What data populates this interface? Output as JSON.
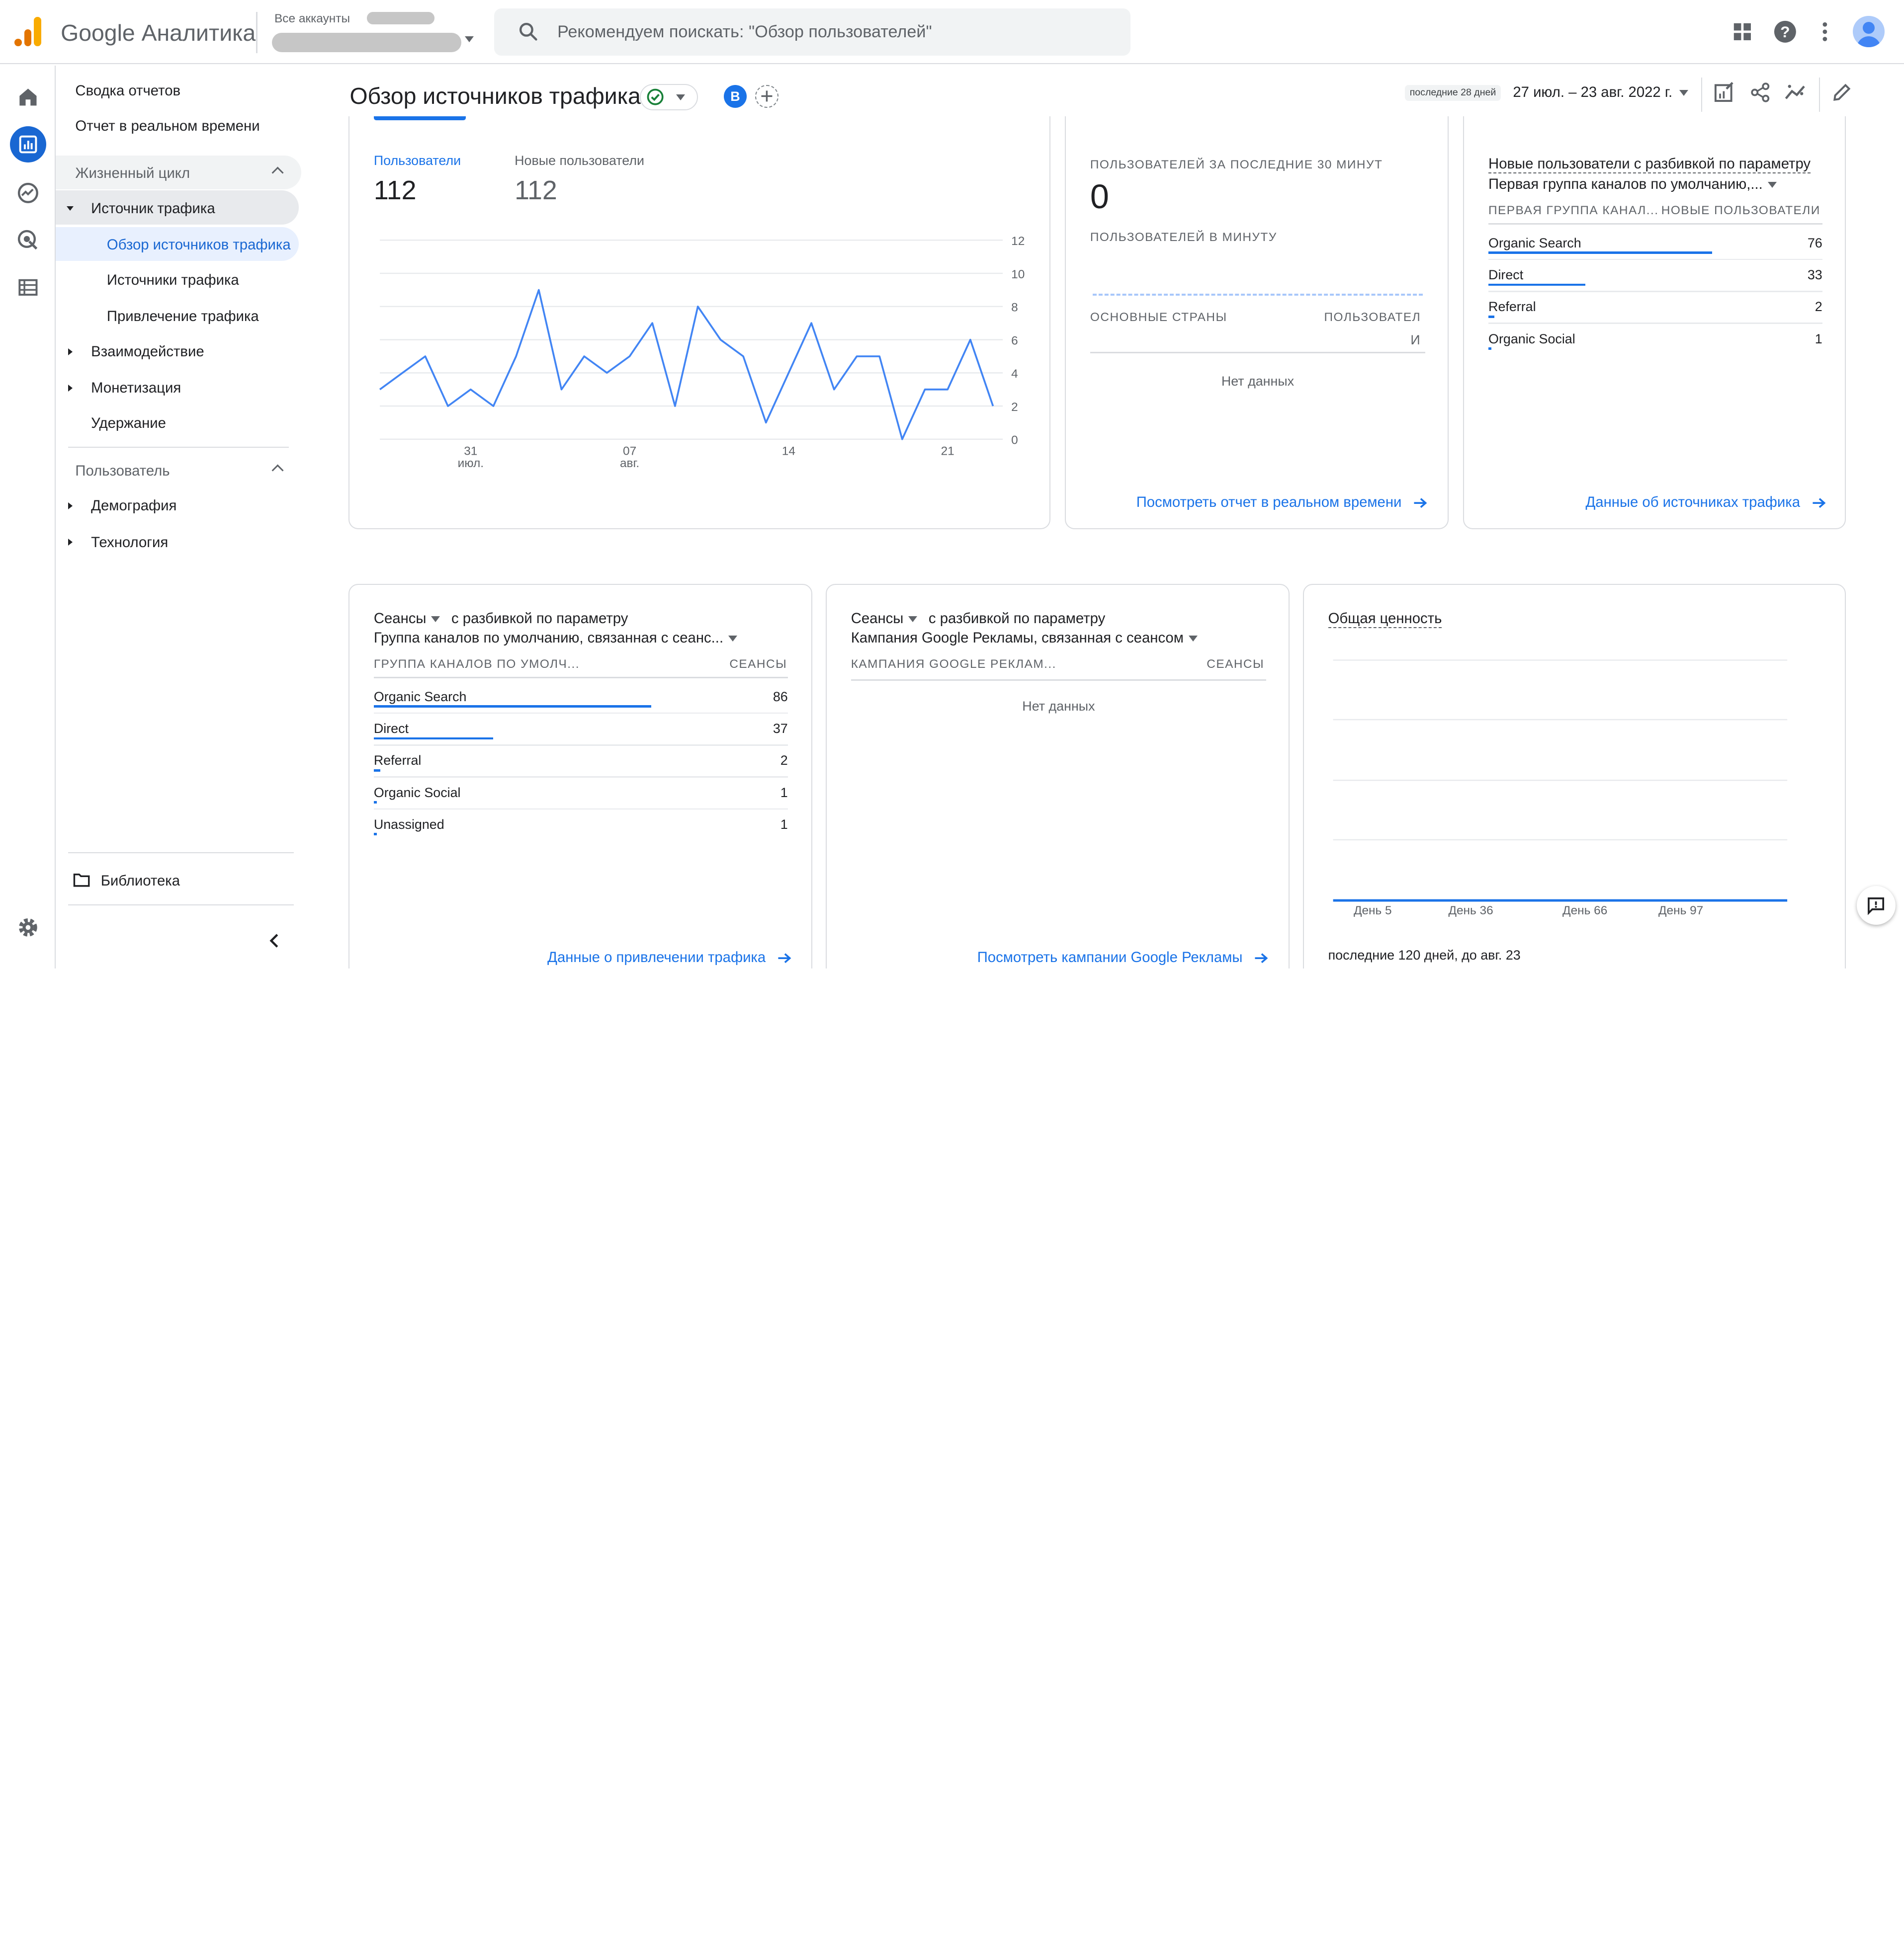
{
  "app": {
    "title": "Google Аналитика",
    "account_label": "Все аккаунты",
    "search_placeholder": "Рекомендуем поискать: \"Обзор пользователей\""
  },
  "nav": {
    "reports_snapshot": "Сводка отчетов",
    "realtime": "Отчет в реальном времени",
    "lifecycle": "Жизненный цикл",
    "acquisition": "Источник трафика",
    "acquisition_overview": "Обзор источников трафика",
    "traffic_sources": "Источники трафика",
    "traffic_acquisition": "Привлечение трафика",
    "engagement": "Взаимодействие",
    "monetization": "Монетизация",
    "retention": "Удержание",
    "user": "Пользователь",
    "demographics": "Демография",
    "tech": "Технология",
    "library": "Библиотека"
  },
  "header": {
    "page_title": "Обзор источников трафика",
    "compare_badge": "В",
    "date_preset": "последние 28 дней",
    "date_range": "27 июл. – 23 авг. 2022 г."
  },
  "users_card": {
    "tab_users": "Пользователи",
    "users_value": "112",
    "tab_new_users": "Новые пользователи",
    "new_users_value": "112",
    "x_labels": [
      {
        "day": "31",
        "month": "июл."
      },
      {
        "day": "07",
        "month": "авг."
      },
      {
        "day": "14",
        "month": ""
      },
      {
        "day": "21",
        "month": ""
      }
    ]
  },
  "chart_data": {
    "type": "line",
    "title": "",
    "xlabel": "",
    "ylabel": "",
    "x": [
      "27 июл.",
      "28 июл.",
      "29 июл.",
      "30 июл.",
      "31 июл.",
      "01 авг.",
      "02 авг.",
      "03 авг.",
      "04 авг.",
      "05 авг.",
      "06 авг.",
      "07 авг.",
      "08 авг.",
      "09 авг.",
      "10 авг.",
      "11 авг.",
      "12 авг.",
      "13 авг.",
      "14 авг.",
      "15 авг.",
      "16 авг.",
      "17 авг.",
      "18 авг.",
      "19 авг.",
      "20 авг.",
      "21 авг.",
      "22 авг.",
      "23 авг."
    ],
    "series": [
      {
        "values": [
          3,
          4,
          5,
          2,
          3,
          2,
          5,
          9,
          3,
          5,
          4,
          5,
          7,
          2,
          8,
          6,
          5,
          1,
          4,
          7,
          3,
          5,
          5,
          0,
          3,
          3,
          6,
          2
        ]
      }
    ],
    "y_ticks": [
      0,
      2,
      4,
      6,
      8,
      10,
      12
    ],
    "ylim": [
      0,
      12
    ],
    "color": "#4285f4",
    "grid": true
  },
  "realtime_card": {
    "title": "ПОЛЬЗОВАТЕЛЕЙ ЗА ПОСЛЕДНИЕ 30 МИНУТ",
    "value": "0",
    "per_minute": "ПОЛЬЗОВАТЕЛЕЙ В МИНУТУ",
    "col_countries": "ОСНОВНЫЕ СТРАНЫ",
    "col_users_1": "ПОЛЬЗОВАТЕЛ",
    "col_users_2": "И",
    "no_data": "Нет данных",
    "link": "Посмотреть отчет в реальном времени"
  },
  "new_users_card": {
    "title": "Новые пользователи с разбивкой по параметру",
    "dimension": "Первая группа каналов по умолчанию,...",
    "col_dim": "ПЕРВАЯ ГРУППА КАНАЛ...",
    "col_metric": "НОВЫЕ ПОЛЬЗОВАТЕЛИ",
    "rows": [
      {
        "label": "Organic Search",
        "value": 76
      },
      {
        "label": "Direct",
        "value": 33
      },
      {
        "label": "Referral",
        "value": 2
      },
      {
        "label": "Organic Social",
        "value": 1
      }
    ],
    "link": "Данные об источниках трафика"
  },
  "sessions_channel_card": {
    "metric": "Сеансы",
    "by": "с разбивкой по параметру",
    "dimension": "Группа каналов по умолчанию, связанная с сеанс...",
    "col_dim": "ГРУППА КАНАЛОВ ПО УМОЛЧ...",
    "col_metric": "СЕАНСЫ",
    "rows": [
      {
        "label": "Organic Search",
        "value": 86
      },
      {
        "label": "Direct",
        "value": 37
      },
      {
        "label": "Referral",
        "value": 2
      },
      {
        "label": "Organic Social",
        "value": 1
      },
      {
        "label": "Unassigned",
        "value": 1
      }
    ],
    "link": "Данные о привлечении трафика"
  },
  "sessions_campaign_card": {
    "metric": "Сеансы",
    "by": "с разбивкой по параметру",
    "dimension": "Кампания Google Рекламы, связанная с сеансом",
    "col_dim": "КАМПАНИЯ GOOGLE РЕКЛАМ...",
    "col_metric": "СЕАНСЫ",
    "no_data": "Нет данных",
    "link": "Посмотреть кампании Google Рекламы"
  },
  "ltv_card": {
    "title": "Общая ценность",
    "x_labels": [
      "День 5",
      "День 36",
      "День 66",
      "День 97"
    ],
    "footer": "последние 120 дней, до авг. 23"
  },
  "colors": {
    "accent": "#1a73e8",
    "line": "#4285f4",
    "logo_orange": "#e37400",
    "logo_yellow": "#f9ab00"
  }
}
